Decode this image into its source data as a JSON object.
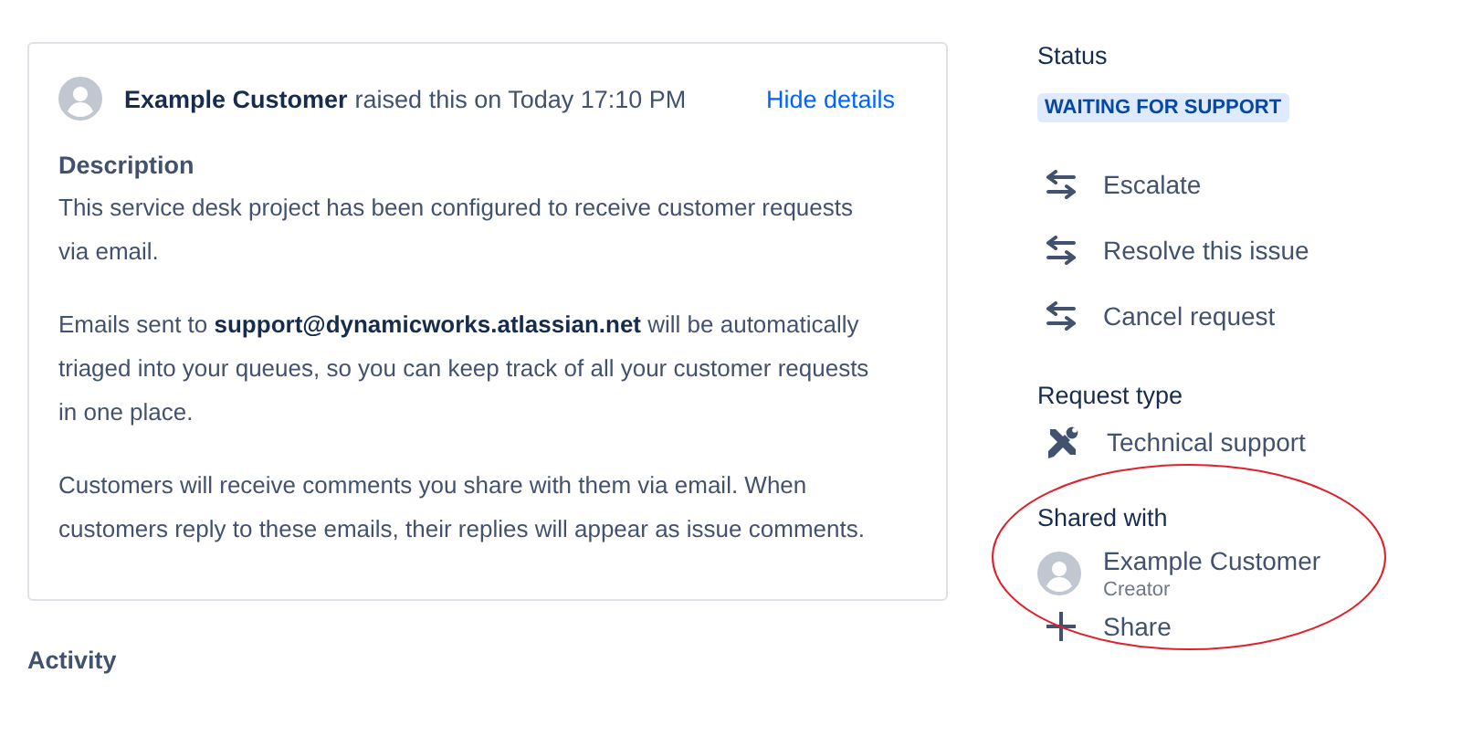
{
  "request": {
    "author": "Example Customer",
    "raised": "raised this on Today 17:10 PM",
    "toggle": "Hide details",
    "description_heading": "Description",
    "paragraphs": [
      "This service desk project has been configured to receive customer requests via email.",
      "Emails sent to **support@dynamicworks.atlassian.net** will be automatically triaged into your queues, so you can keep track of all your customer requests in one place.",
      "Customers will receive comments you share with them via email. When customers reply to these emails, their replies will appear as issue comments."
    ]
  },
  "activity": {
    "heading": "Activity"
  },
  "status": {
    "heading": "Status",
    "value": "WAITING FOR SUPPORT"
  },
  "actions": [
    {
      "label": "Escalate"
    },
    {
      "label": "Resolve this issue"
    },
    {
      "label": "Cancel request"
    }
  ],
  "request_type": {
    "heading": "Request type",
    "value": "Technical support"
  },
  "shared_with": {
    "heading": "Shared with",
    "people": [
      {
        "name": "Example Customer",
        "role": "Creator"
      }
    ],
    "share": "Share",
    "highlighted": true
  }
}
